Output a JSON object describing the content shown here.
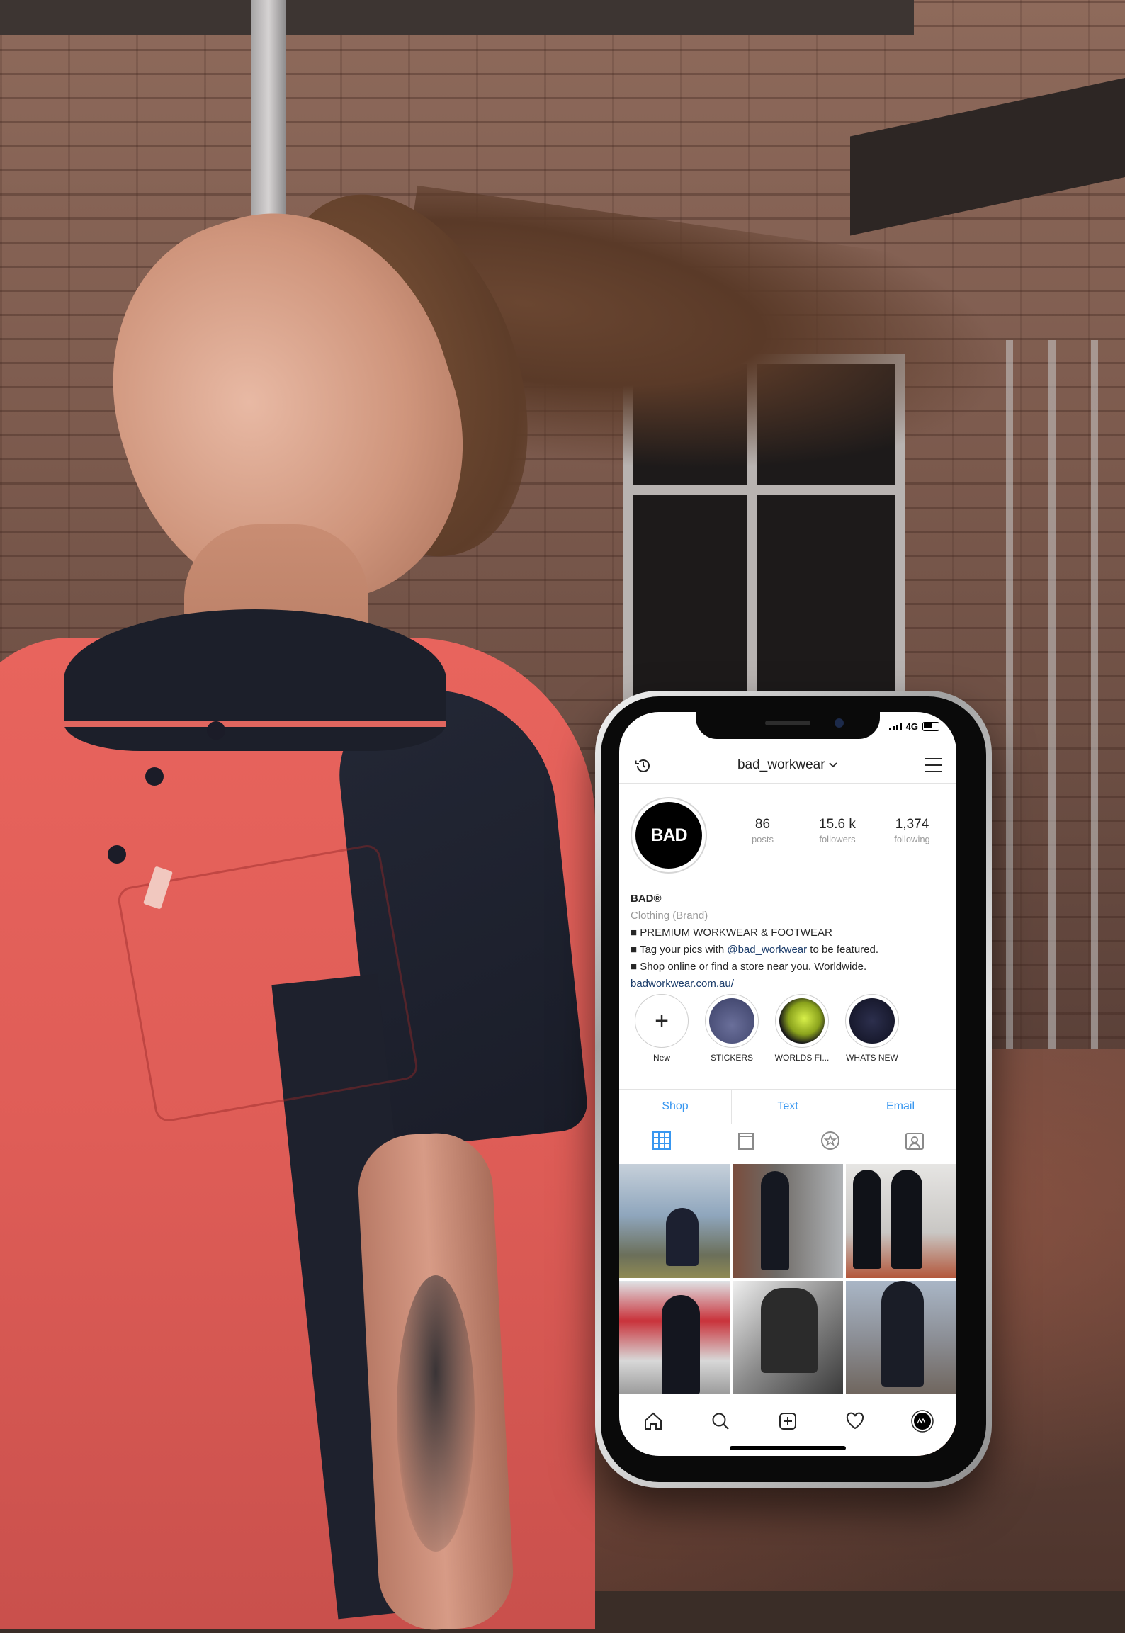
{
  "status_bar": {
    "network": "4G"
  },
  "profile": {
    "username": "bad_workwear",
    "avatar_text": "BAD",
    "stats": [
      {
        "value": "86",
        "label": "posts"
      },
      {
        "value": "15.6 k",
        "label": "followers"
      },
      {
        "value": "1,374",
        "label": "following"
      }
    ],
    "name": "BAD®",
    "category": "Clothing (Brand)",
    "bio_line1": "■ PREMIUM WORKWEAR & FOOTWEAR",
    "bio_line2_pre": "■ Tag your pics with ",
    "bio_line2_mention": "@bad_workwear",
    "bio_line2_post": " to be featured.",
    "bio_line3": "■ Shop online or find a store near you. Worldwide.",
    "website": "badworkwear.com.au/"
  },
  "highlights": [
    {
      "label": "New",
      "color": "#ffffff"
    },
    {
      "label": "STICKERS",
      "color": "#3a3f66"
    },
    {
      "label": "WORLDS FI...",
      "color": "#b8d435"
    },
    {
      "label": "WHATS NEW",
      "color": "#1b1d33"
    }
  ],
  "actions": [
    "Shop",
    "Text",
    "Email"
  ],
  "tabs": [
    "grid-icon",
    "igtv-icon",
    "saved-icon",
    "tagged-icon"
  ],
  "grid_posts": [
    {
      "bg": "#8fa6bd",
      "fig": "#1c2030"
    },
    {
      "bg": "#6e6a66",
      "fig": "#151821"
    },
    {
      "bg": "#c9c7c4",
      "fig": "#101218"
    },
    {
      "bg": "#c9323a",
      "fig": "#14161f"
    },
    {
      "bg": "#7a7a7a",
      "fig": "#2b2b2b"
    },
    {
      "bg": "#8c8f96",
      "fig": "#1a1d27"
    }
  ],
  "bottom_nav": [
    "home-icon",
    "search-icon",
    "new-post-icon",
    "activity-icon",
    "profile-icon"
  ],
  "colors": {
    "accent": "#3897f0",
    "link": "#1b3c6a",
    "shirt": "#e8645d"
  }
}
